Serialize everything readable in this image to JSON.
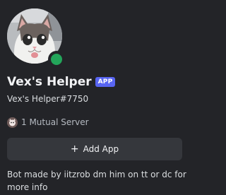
{
  "profile": {
    "display_name": "Vex's Helper",
    "badge": "APP",
    "username": "Vex's Helper#7750",
    "status": "online",
    "avatar_icon": "cat-photo-avatar",
    "mutual_servers": "1 Mutual Server",
    "bio": "Bot made by iitzrob dm him on tt or dc for more info"
  },
  "actions": {
    "add_app_label": "Add App",
    "add_app_icon": "+"
  },
  "colors": {
    "background": "#232428",
    "badge": "#5865f2",
    "status_online": "#23a55a",
    "button": "#35373c"
  }
}
